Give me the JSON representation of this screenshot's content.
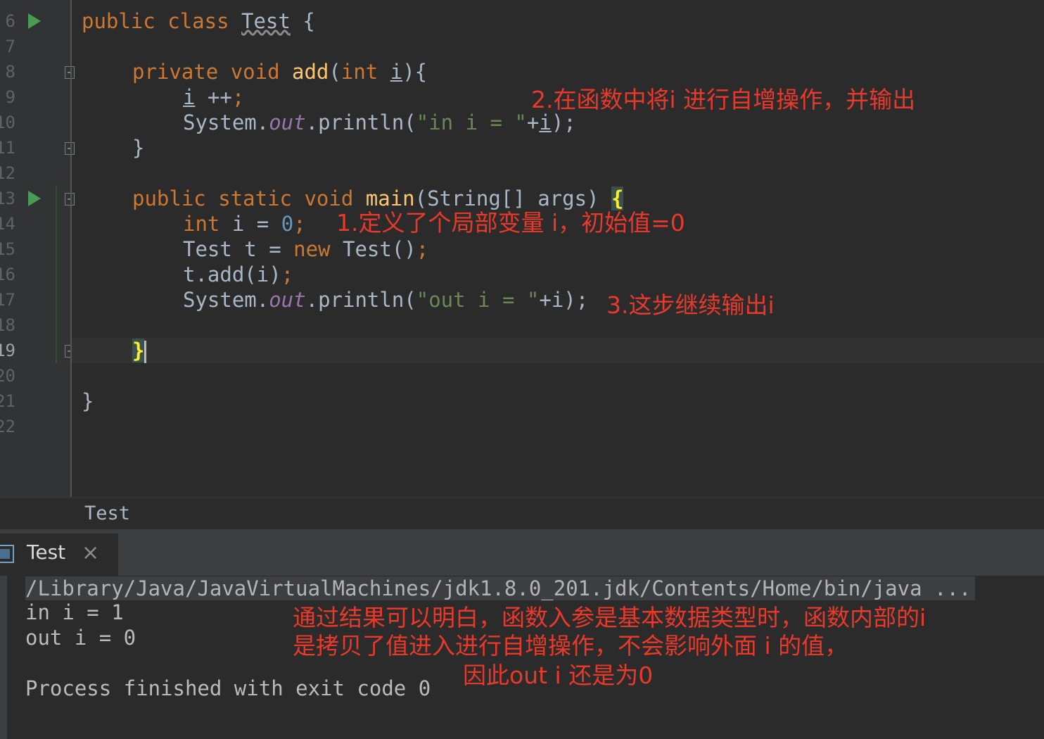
{
  "gutter": {
    "line_numbers": [
      "6",
      "7",
      "8",
      "9",
      "10",
      "11",
      "12",
      "13",
      "14",
      "15",
      "16",
      "17",
      "18",
      "19",
      "20",
      "21",
      "22"
    ]
  },
  "code": {
    "class_decl": {
      "kw1": "public",
      "kw2": "class",
      "name": "Test",
      "brace": "{"
    },
    "add_decl": {
      "kw1": "private",
      "kw2": "void",
      "name": "add",
      "open": "(",
      "type": "int",
      "param": "i",
      "close": "){"
    },
    "add_inc": {
      "var": "i",
      "op": " ++",
      "semi": ";"
    },
    "add_print": {
      "sys": "System.",
      "out": "out",
      "call": ".println(",
      "str": "\"in i = \"",
      "plus": "+",
      "var": "i",
      "end": ");"
    },
    "close_brace": "}",
    "main_decl": {
      "kw1": "public",
      "kw2": "static",
      "kw3": "void",
      "name": "main",
      "params": "(String[] args) ",
      "brace": "{"
    },
    "main_int": {
      "kw": "int",
      "mid": " i = ",
      "num": "0",
      "semi": ";"
    },
    "main_new": {
      "pre": "Test t = ",
      "kw": "new",
      "post": " Test()",
      "semi": ";"
    },
    "main_add": {
      "text": "t.add(i)",
      "semi": ";"
    },
    "main_print": {
      "sys": "System.",
      "out": "out",
      "call": ".println(",
      "str": "\"out i = \"",
      "end": "+i);"
    },
    "main_close": "}",
    "class_close": "}"
  },
  "annotations": {
    "a2": "2.在函数中将i 进行自增操作，并输出",
    "a1": "1.定义了个局部变量 i，初始值=0",
    "a3": "3.这步继续输出i",
    "summary1": "通过结果可以明白，函数入参是基本数据类型时，函数内部的i",
    "summary2": "是拷贝了值进入进行自增操作，不会影响外面 i 的值，",
    "summary3": "因此out i 还是为0"
  },
  "breadcrumb": "Test",
  "run_panel": {
    "tab_label": "Test",
    "close_glyph": "×",
    "command": "/Library/Java/JavaVirtualMachines/jdk1.8.0_201.jdk/Contents/Home/bin/java ...",
    "output": [
      "in i = 1",
      "out i = 0"
    ],
    "exit_msg": "Process finished with exit code 0"
  }
}
